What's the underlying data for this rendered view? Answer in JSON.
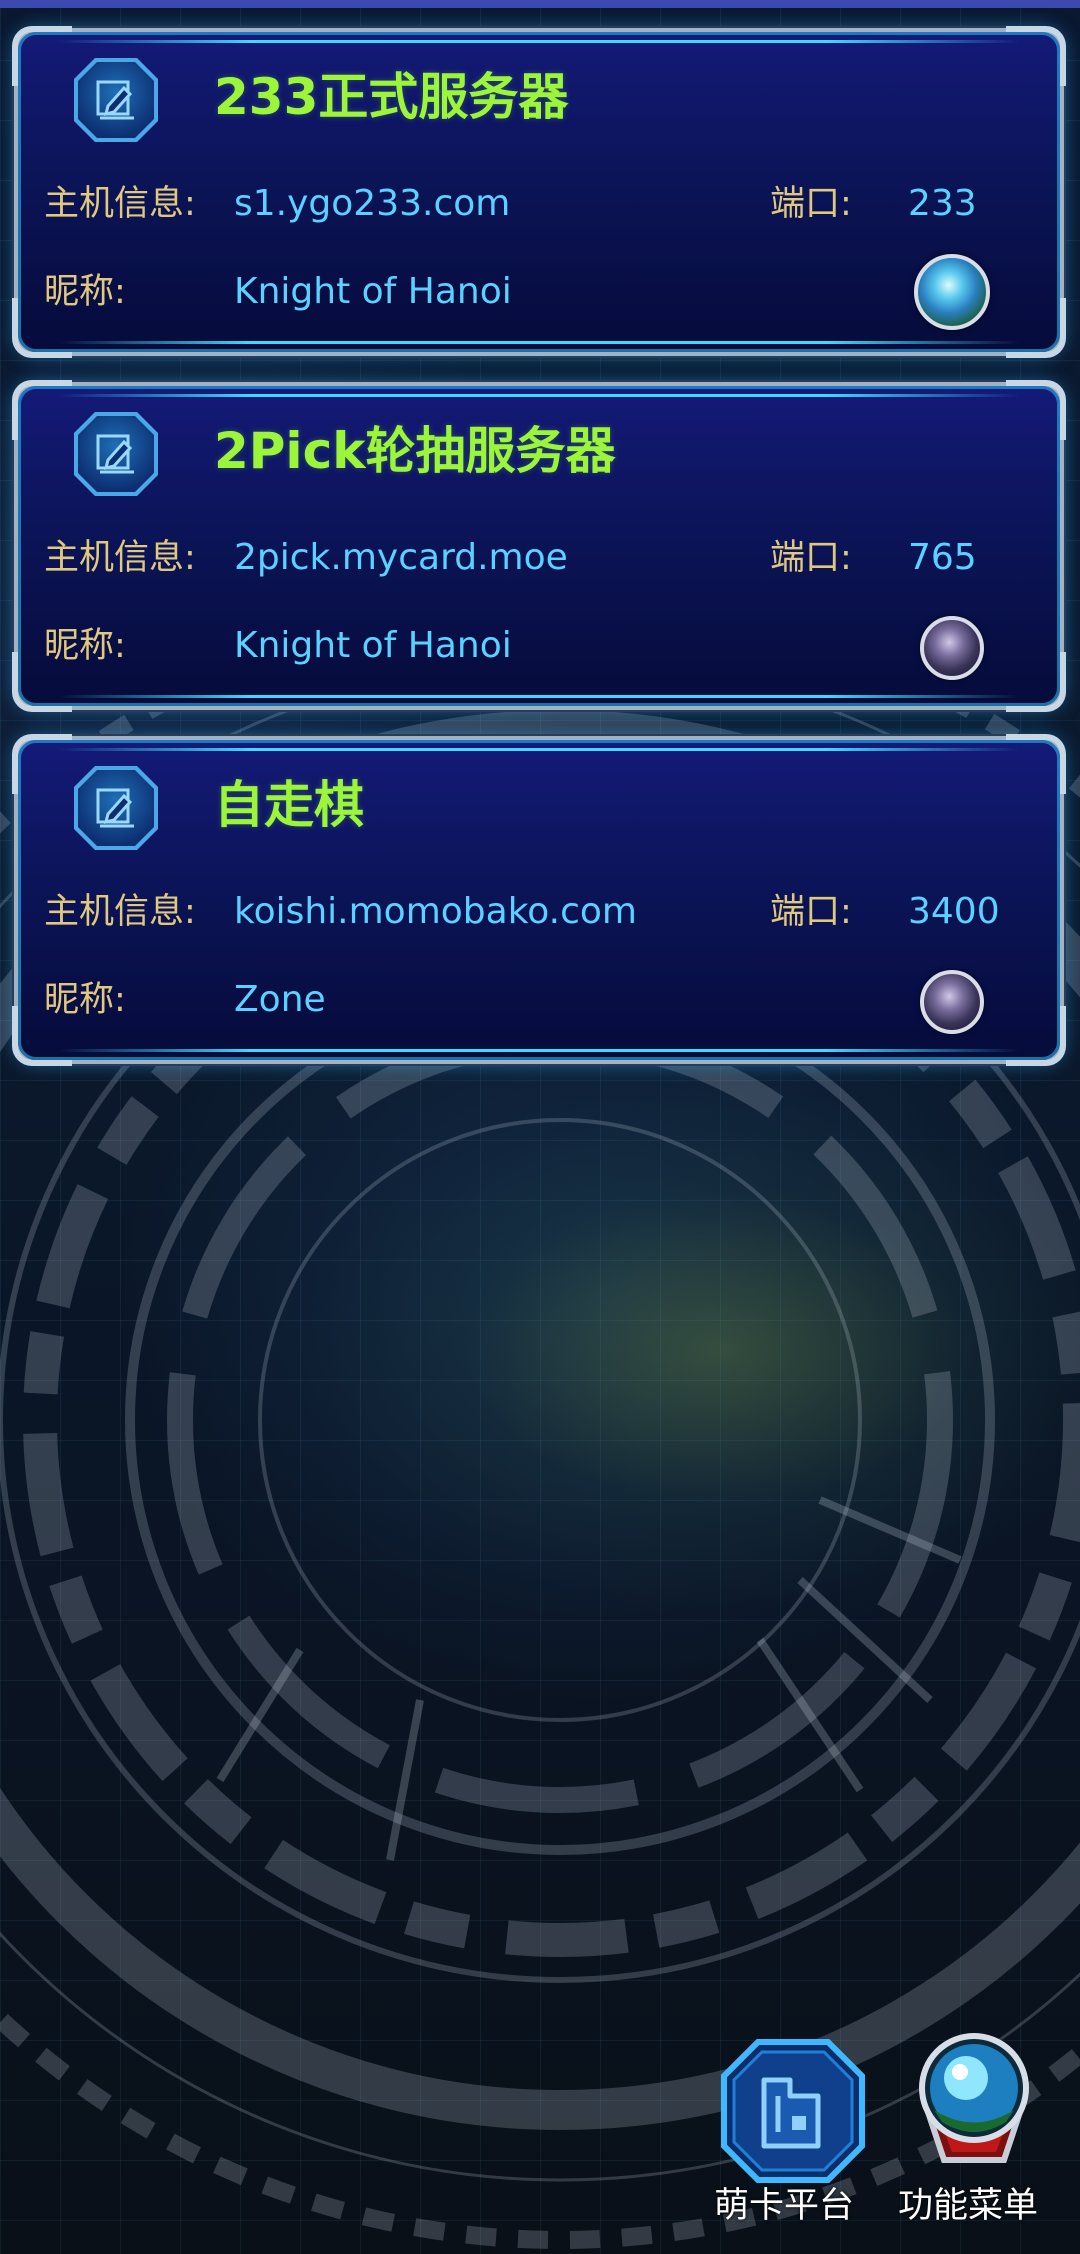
{
  "servers": [
    {
      "title": "233正式服务器",
      "host_label": "主机信息:",
      "host": "s1.ygo233.com",
      "port_label": "端口:",
      "port": "233",
      "nickname_label": "昵称:",
      "nickname": "Knight of Hanoi",
      "avatar_state": "active"
    },
    {
      "title": "2Pick轮抽服务器",
      "host_label": "主机信息:",
      "host": "2pick.mycard.moe",
      "port_label": "端口:",
      "port": "765",
      "nickname_label": "昵称:",
      "nickname": "Knight of Hanoi",
      "avatar_state": "inactive"
    },
    {
      "title": "自走棋",
      "host_label": "主机信息:",
      "host": "koishi.momobako.com",
      "port_label": "端口:",
      "port": "3400",
      "nickname_label": "昵称:",
      "nickname": "Zone",
      "avatar_state": "inactive"
    }
  ],
  "bottom_bar": {
    "mycard_label": "萌卡平台",
    "menu_label": "功能菜单"
  },
  "colors": {
    "title": "#9cf53a",
    "label": "#e0c87e",
    "value": "#5ad2ff",
    "card_bg": "#0b1458",
    "top_bar": "#3b49b0"
  },
  "icons": {
    "edit": "pencil-edit-icon",
    "status": "avatar-status-icon",
    "mycard": "mycard-platform-icon",
    "menu": "function-menu-icon"
  }
}
